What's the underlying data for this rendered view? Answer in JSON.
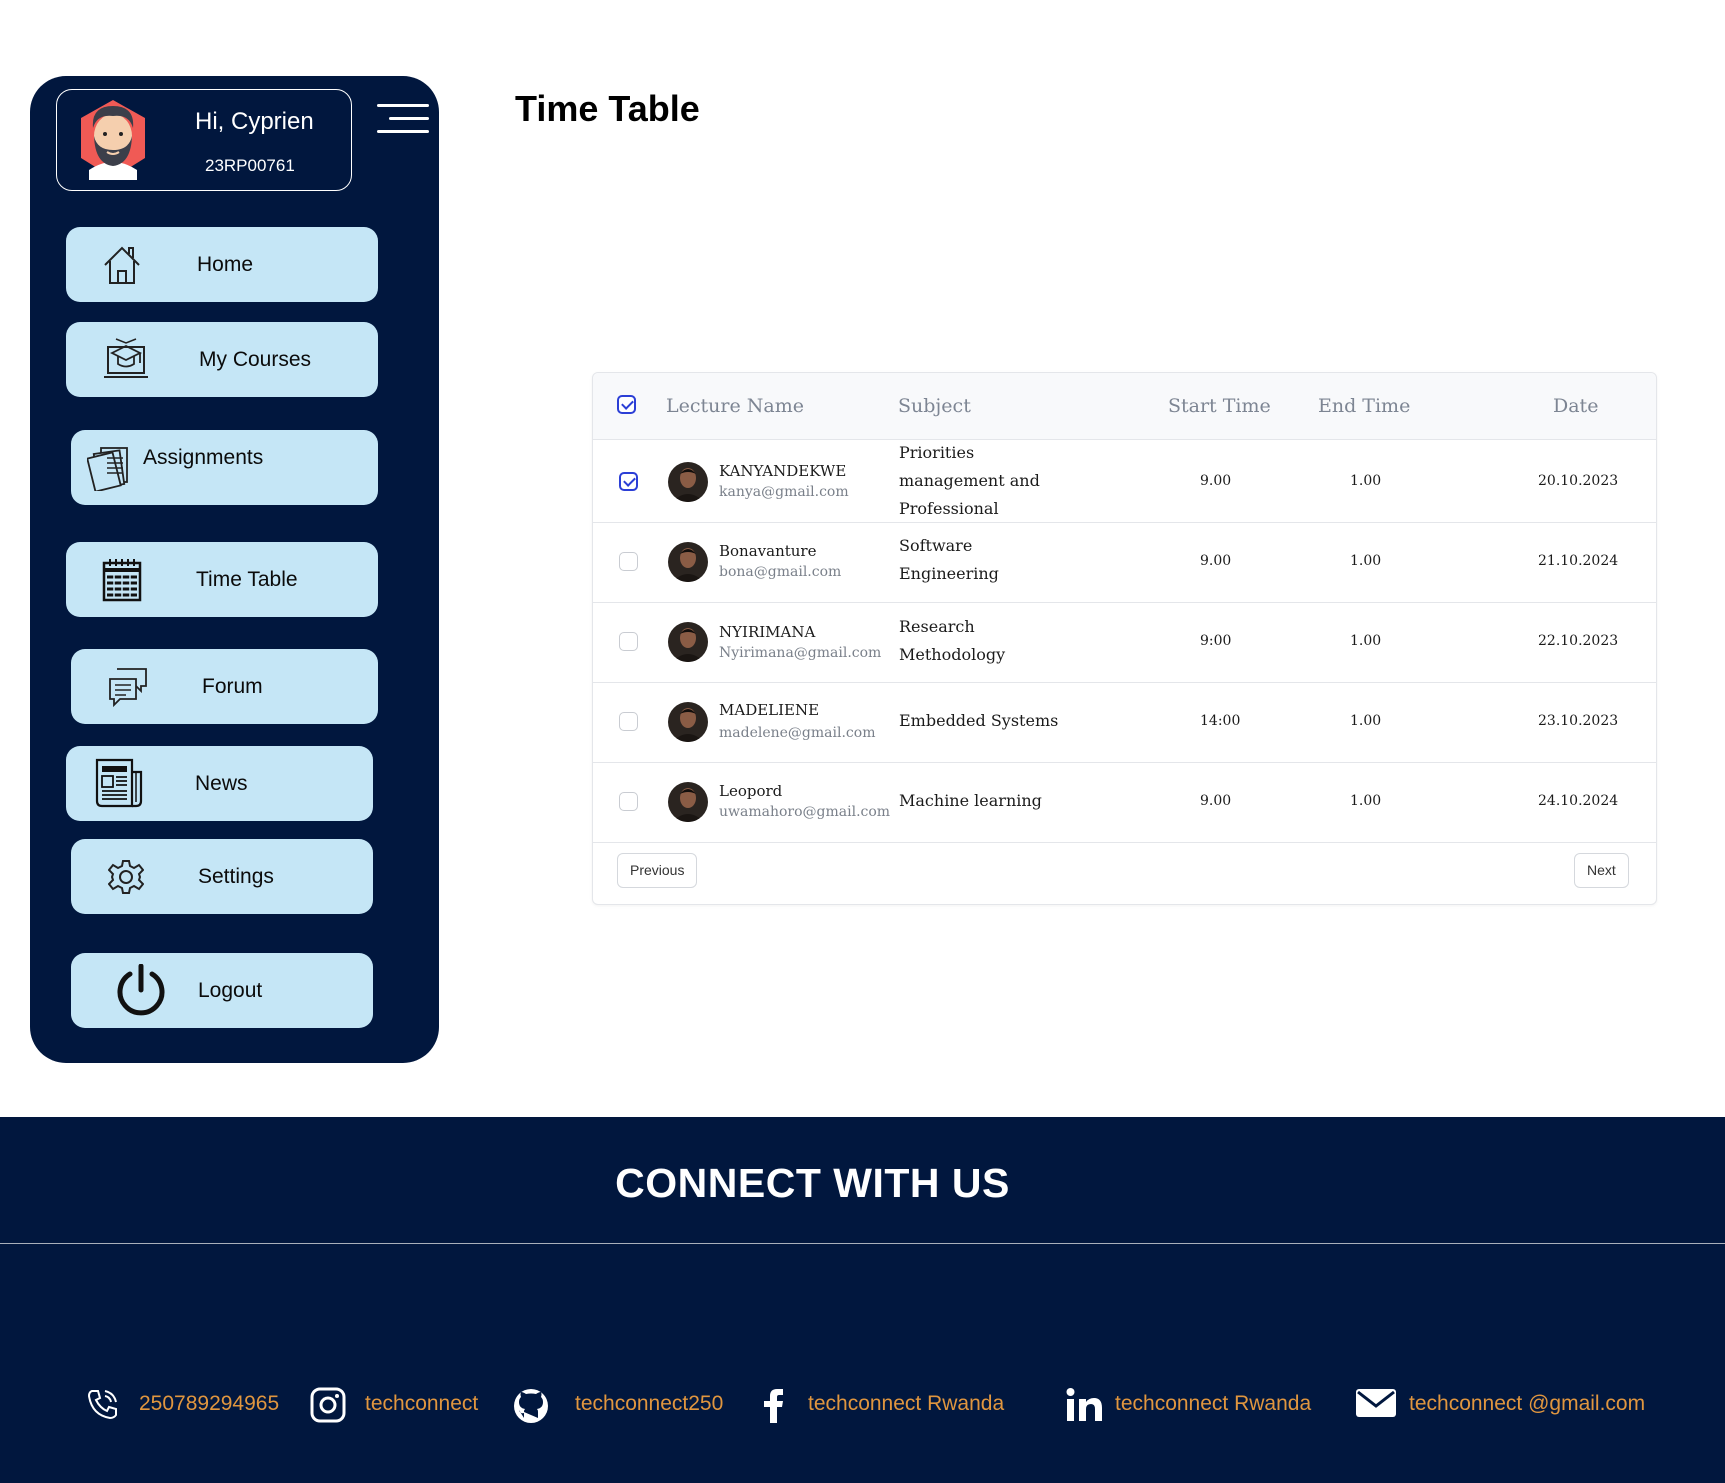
{
  "sidebar": {
    "greeting": "Hi, Cyprien",
    "student_id": "23RP00761",
    "nav": {
      "home": "Home",
      "my_courses": "My Courses",
      "assignments": "Assignments",
      "time_table": "Time Table",
      "forum": "Forum",
      "news": "News",
      "settings": "Settings",
      "logout": "Logout"
    }
  },
  "page": {
    "title": "Time Table"
  },
  "table": {
    "headers": {
      "lecture": "Lecture Name",
      "subject": "Subject",
      "start": "Start Time",
      "end": "End Time",
      "date": "Date"
    },
    "header_checked": true,
    "rows": [
      {
        "checked": true,
        "name": "KANYANDEKWE",
        "email": "kanya@gmail.com",
        "subject": "Priorities management and Professional",
        "start": "9.00",
        "end": "1.00",
        "date": "20.10.2023"
      },
      {
        "checked": false,
        "name": "Bonavanture",
        "email": "bona@gmail.com",
        "subject": "Software Engineering",
        "start": "9.00",
        "end": "1.00",
        "date": "21.10.2024"
      },
      {
        "checked": false,
        "name": "NYIRIMANA",
        "email": "Nyirimana@gmail.com",
        "subject": "Research Methodology",
        "start": "9:00",
        "end": "1.00",
        "date": "22.10.2023"
      },
      {
        "checked": false,
        "name": "MADELIENE",
        "email": "madelene@gmail.com",
        "subject": "Embedded Systems",
        "start": "14:00",
        "end": "1.00",
        "date": "23.10.2023"
      },
      {
        "checked": false,
        "name": "Leopord",
        "email": "uwamahoro@gmail.com",
        "subject": "Machine learning",
        "start": "9.00",
        "end": "1.00",
        "date": "24.10.2024"
      }
    ],
    "pagination": {
      "previous": "Previous",
      "next": "Next"
    }
  },
  "footer": {
    "title": "CONNECT WITH US",
    "contacts": {
      "phone": "250789294965",
      "instagram": "techconnect",
      "github": "techconnect250",
      "facebook": "techconnect Rwanda",
      "linkedin": "techconnect Rwanda",
      "email": "techconnect @gmail.com"
    }
  },
  "colors": {
    "navy": "#01173e",
    "nav_button": "#c5e6f6",
    "footer_link": "#e0963f",
    "checkbox_accent": "#2c3fd6"
  }
}
